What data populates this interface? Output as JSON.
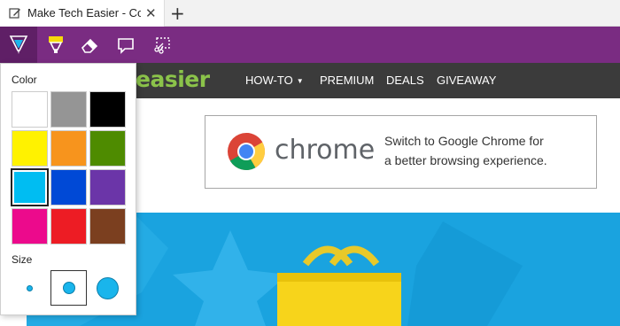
{
  "tab": {
    "title": "Make Tech Easier - Com",
    "close": "✕",
    "new_tab": "+"
  },
  "ink_toolbar": {
    "tools": [
      {
        "name": "ballpoint-pen",
        "active": true
      },
      {
        "name": "highlighter",
        "active": false
      },
      {
        "name": "eraser",
        "active": false
      },
      {
        "name": "add-note",
        "active": false
      },
      {
        "name": "clip",
        "active": false
      }
    ],
    "color": "#7a2c82"
  },
  "pen_flyout": {
    "color_label": "Color",
    "size_label": "Size",
    "colors": [
      "#ffffff",
      "#959595",
      "#000000",
      "#fff200",
      "#f7941d",
      "#4e8b00",
      "#00bdf2",
      "#0049d6",
      "#6b35a8",
      "#ec0a8c",
      "#ed1c24",
      "#7b3f1f"
    ],
    "selected_color": "#00bdf2",
    "sizes": [
      "small",
      "medium",
      "large"
    ],
    "selected_size": "medium"
  },
  "site": {
    "logo_text": "easier",
    "nav": {
      "howto": "HOW-TO",
      "premium": "PREMIUM",
      "deals": "DEALS",
      "giveaway": "GIVEAWAY"
    },
    "ad": {
      "brand": "chrome",
      "line1": "Switch to Google Chrome for",
      "line2": "a better browsing experience."
    }
  }
}
